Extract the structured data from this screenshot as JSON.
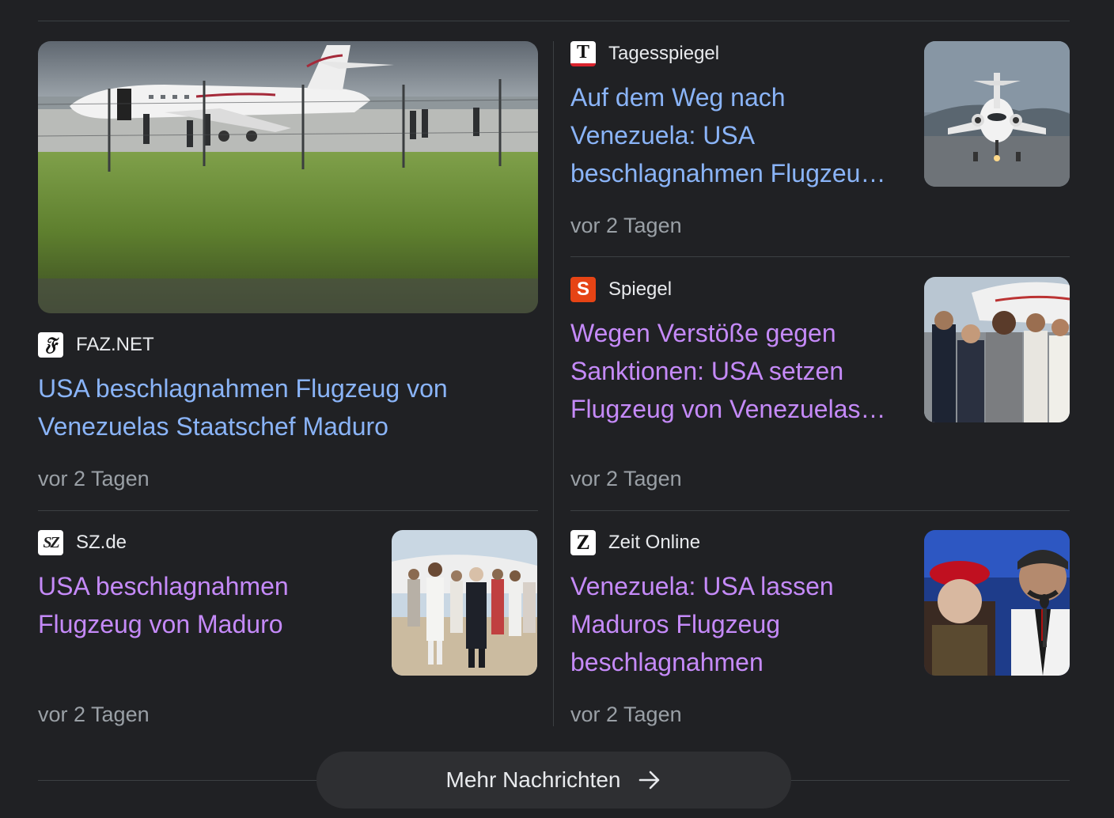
{
  "articles": [
    {
      "source": "FAZ.NET",
      "favicon_glyph": "𝔉",
      "headline": "USA beschlagnahmen Flugzeug von Venezuelas Staatschef Maduro",
      "time": "vor 2 Tagen",
      "visited": false,
      "image": "parked-jet-behind-fence-photo"
    },
    {
      "source": "Tagesspiegel",
      "favicon_glyph": "T",
      "headline": "Auf dem Weg nach Venezuela: USA beschlagnahmen Flugzeu…",
      "time": "vor 2 Tagen",
      "visited": false,
      "image": "jet-front-view-photo"
    },
    {
      "source": "Spiegel",
      "favicon_glyph": "S",
      "headline": "Wegen Verstöße gegen Sanktionen: USA setzen Flugzeug von Venezuelas…",
      "time": "vor 2 Tagen",
      "visited": true,
      "image": "officials-at-jet-photo"
    },
    {
      "source": "SZ.de",
      "favicon_glyph": "SZ",
      "headline": "USA beschlagnahmen Flugzeug von Maduro",
      "time": "vor 2 Tagen",
      "visited": true,
      "image": "delegation-walking-photo"
    },
    {
      "source": "Zeit Online",
      "favicon_glyph": "Z",
      "headline": "Venezuela: USA lassen Maduros Flugzeug beschlagnahmen",
      "time": "vor 2 Tagen",
      "visited": true,
      "image": "maduro-at-microphone-photo"
    }
  ],
  "more_button": {
    "label": "Mehr Nachrichten",
    "icon": "arrow-right-icon"
  },
  "colors": {
    "background": "#202124",
    "link_unvisited": "#8ab4f8",
    "link_visited": "#c58af9",
    "meta_text": "#9aa0a6",
    "divider": "#3c4043"
  }
}
